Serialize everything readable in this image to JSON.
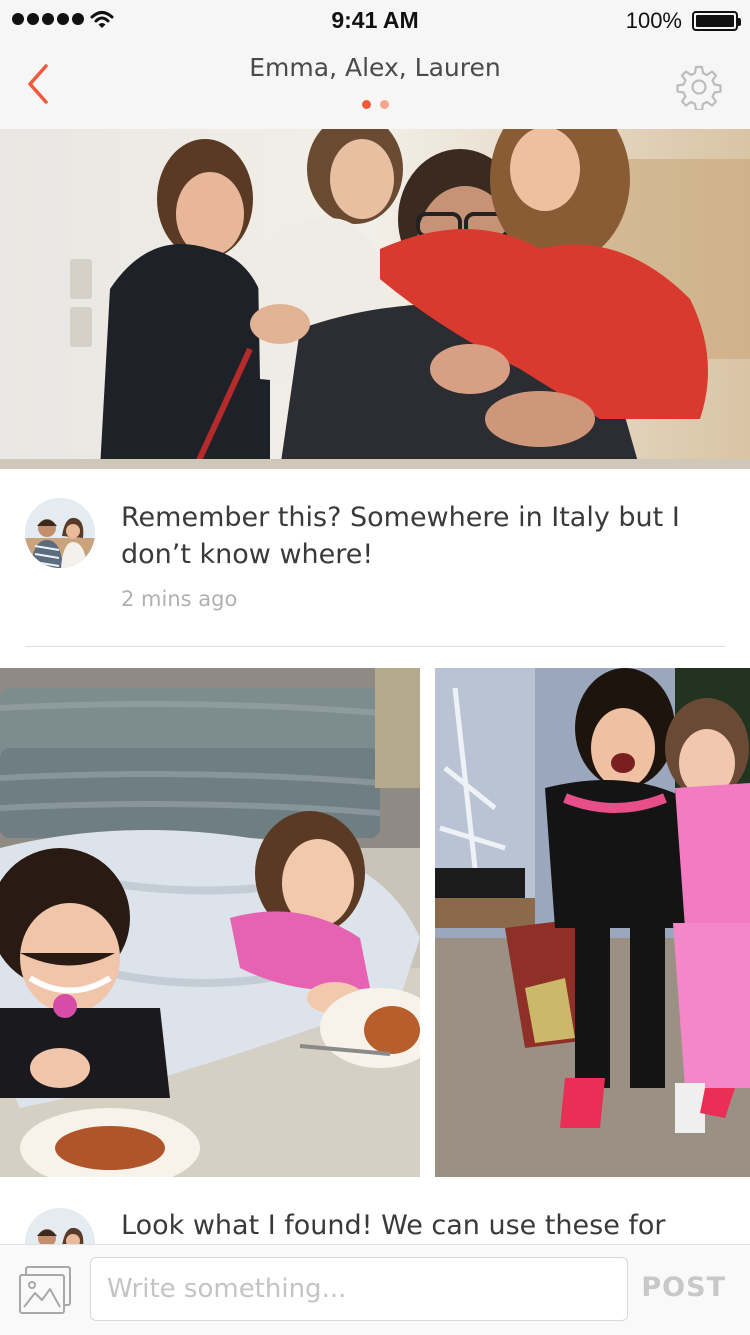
{
  "status_bar": {
    "time": "9:41 AM",
    "battery": "100%"
  },
  "header": {
    "title": "Emma, Alex, Lauren",
    "page_dots": {
      "count": 2,
      "active": 0,
      "active_color": "#f05a3a",
      "inactive_color": "#f6a58f"
    },
    "accent_color": "#f05a3a",
    "back_icon": "chevron-left-icon",
    "settings_icon": "gear-icon"
  },
  "posts": [
    {
      "text": "Remember this? Somewhere in Italy but I don’t know where!",
      "time": "2 mins ago"
    },
    {
      "text": "Look what I found! We can use these for"
    }
  ],
  "composer": {
    "placeholder": "Write something...",
    "post_label": "POST",
    "gallery_icon": "photo-gallery-icon"
  }
}
